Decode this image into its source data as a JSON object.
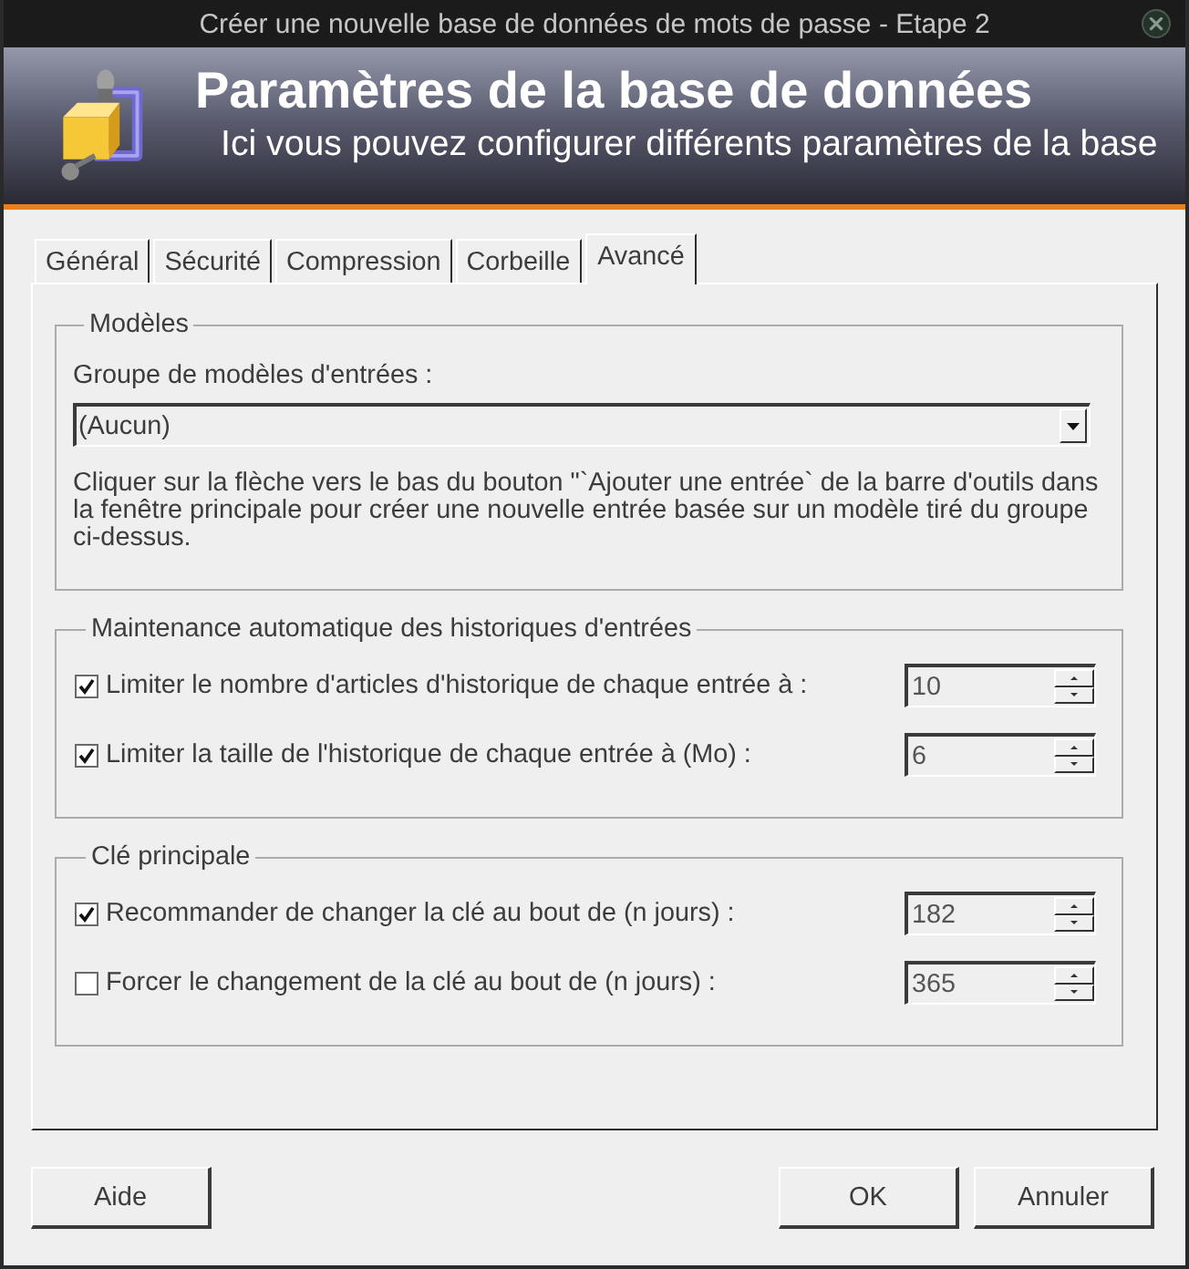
{
  "window": {
    "title": "Créer une nouvelle base de données de mots de passe - Etape 2"
  },
  "header": {
    "title": "Paramètres de la base de données",
    "subtitle": "Ici vous pouvez configurer différents paramètres de la base"
  },
  "tabs": [
    {
      "label": "Général",
      "selected": false
    },
    {
      "label": "Sécurité",
      "selected": false
    },
    {
      "label": "Compression",
      "selected": false
    },
    {
      "label": "Corbeille",
      "selected": false
    },
    {
      "label": "Avancé",
      "selected": true
    }
  ],
  "groups": [
    {
      "kind": "template",
      "title": "Modèles",
      "field_label": "Groupe de modèles d'entrées :",
      "dropdown": {
        "value": "(Aucun)"
      },
      "description": "Cliquer sur la flèche vers le bas du bouton \"`Ajouter une entrée` de la barre d'outils dans la fenêtre principale pour créer une nouvelle entrée basée sur un modèle tiré du groupe ci-dessus."
    },
    {
      "kind": "options",
      "title": "Maintenance automatique des historiques d'entrées",
      "options": [
        {
          "label": "Limiter le nombre d'articles d'historique de chaque entrée à :",
          "checked": true,
          "value": "10"
        },
        {
          "label": "Limiter la taille de l'historique de chaque entrée à (Mo) :",
          "checked": true,
          "value": "6"
        }
      ]
    },
    {
      "kind": "options",
      "title": "Clé principale",
      "options": [
        {
          "label": "Recommander de changer la clé au bout de (n jours) :",
          "checked": true,
          "value": "182"
        },
        {
          "label": "Forcer le changement de la clé au bout de (n jours) :",
          "checked": false,
          "value": "365"
        }
      ]
    }
  ],
  "footer": {
    "left_buttons": [
      {
        "label": "Aide"
      }
    ],
    "right_buttons": [
      {
        "label": "OK"
      },
      {
        "label": "Annuler"
      }
    ]
  }
}
